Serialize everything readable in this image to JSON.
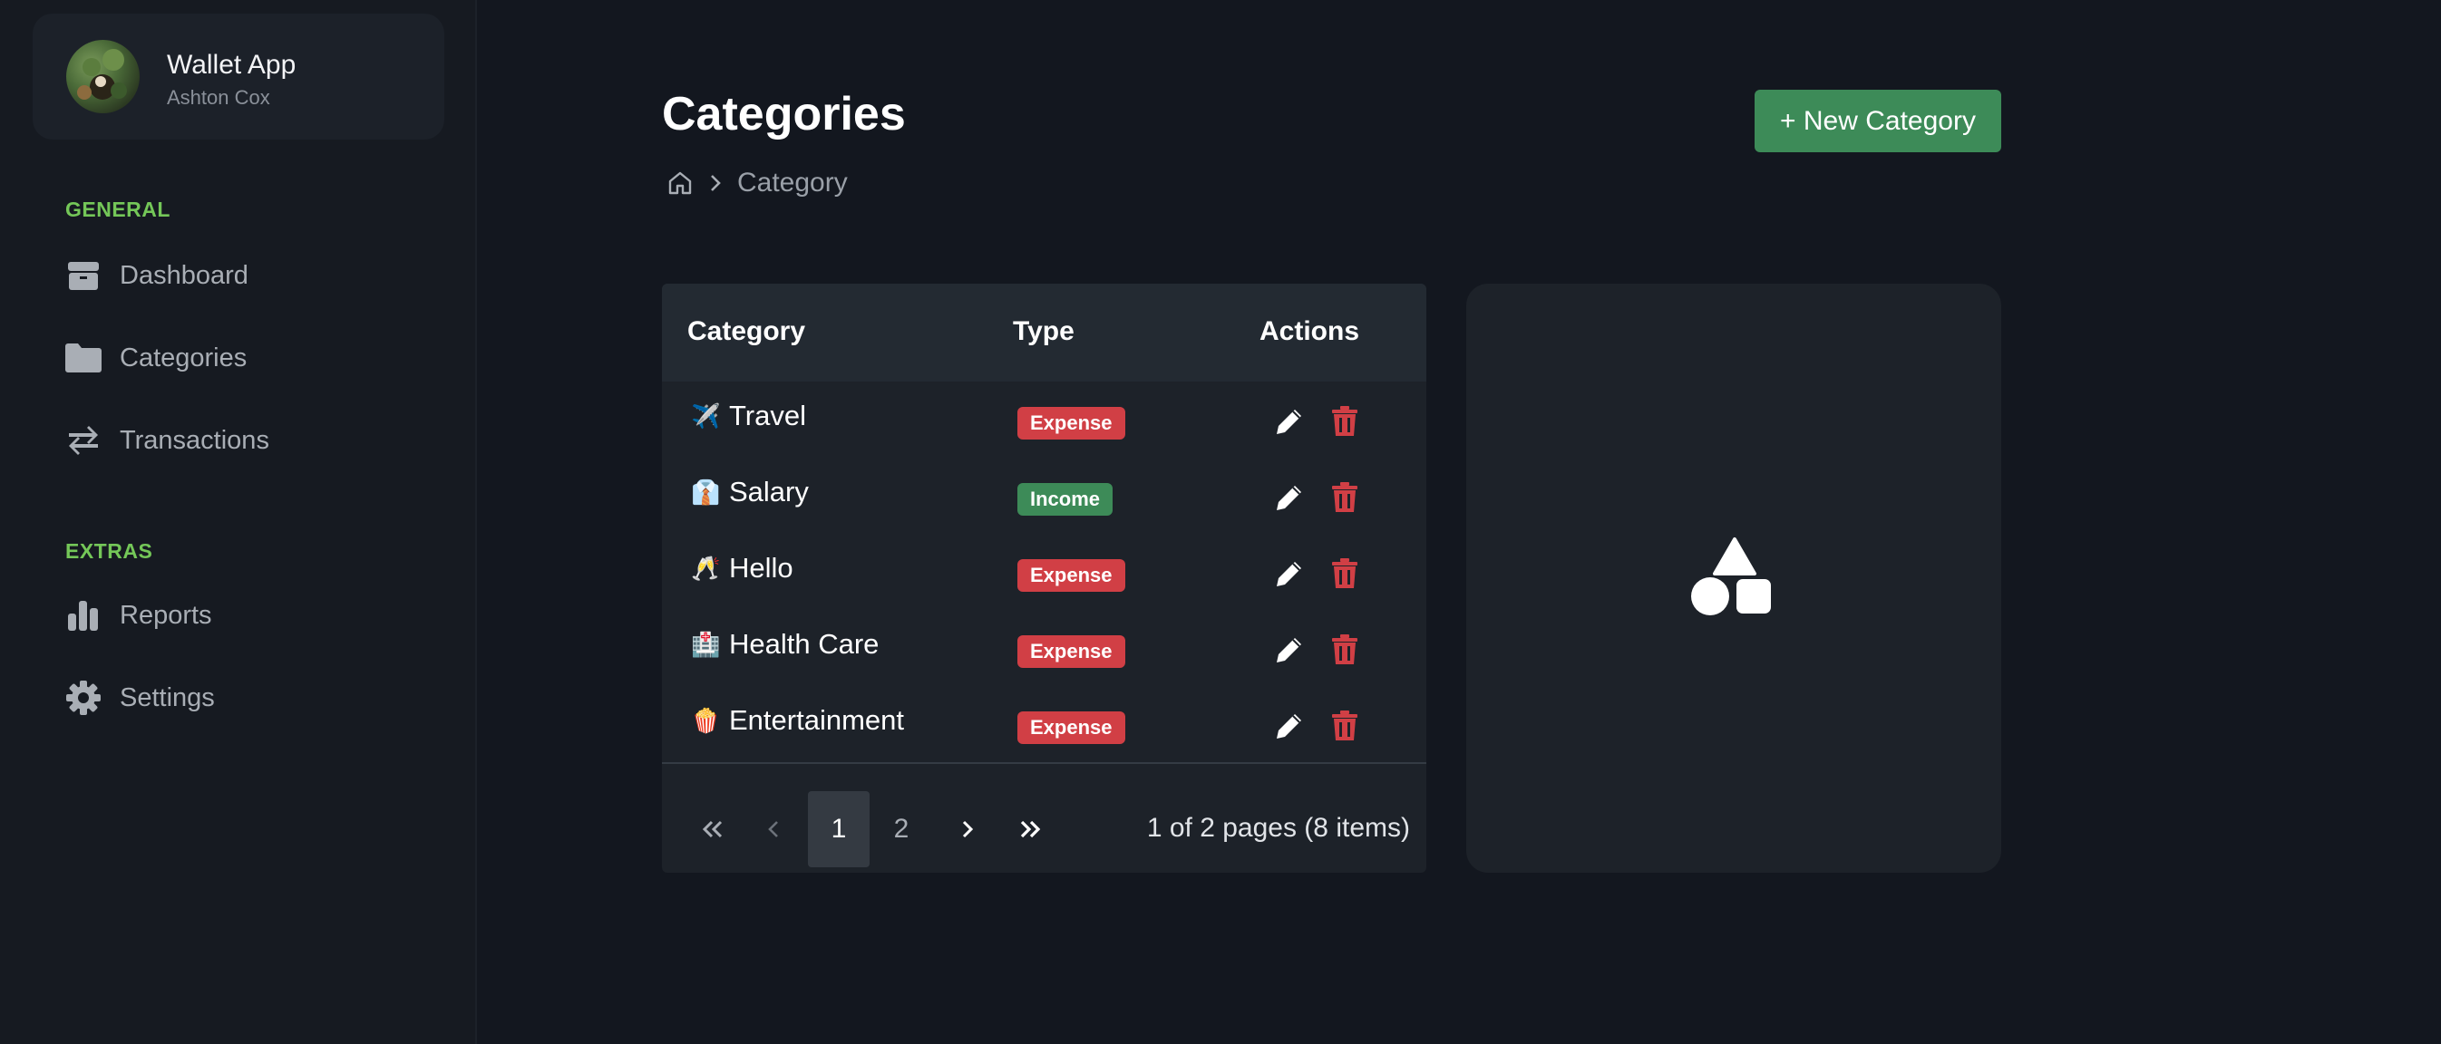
{
  "sidebar": {
    "app_name": "Wallet App",
    "user_name": "Ashton Cox",
    "sections": [
      {
        "label": "GENERAL",
        "items": [
          {
            "label": "Dashboard",
            "icon": "box-icon"
          },
          {
            "label": "Categories",
            "icon": "folder-icon"
          },
          {
            "label": "Transactions",
            "icon": "arrows-exchange-icon"
          }
        ]
      },
      {
        "label": "EXTRAS",
        "items": [
          {
            "label": "Reports",
            "icon": "bar-chart-icon"
          },
          {
            "label": "Settings",
            "icon": "gear-icon"
          }
        ]
      }
    ]
  },
  "header": {
    "title": "Categories",
    "breadcrumb": [
      "Category"
    ],
    "new_button_label": "+ New Category"
  },
  "table": {
    "columns": [
      "Category",
      "Type",
      "Actions"
    ],
    "rows": [
      {
        "emoji": "✈️",
        "name": "Travel",
        "type": "Expense"
      },
      {
        "emoji": "👔",
        "name": "Salary",
        "type": "Income"
      },
      {
        "emoji": "🥂",
        "name": "Hello",
        "type": "Expense"
      },
      {
        "emoji": "🏥",
        "name": "Health Care",
        "type": "Expense"
      },
      {
        "emoji": "🍿",
        "name": "Entertainment",
        "type": "Expense"
      }
    ],
    "pagination": {
      "pages": [
        "1",
        "2"
      ],
      "current_page": 1,
      "info": "1 of 2 pages (8 items)"
    }
  },
  "colors": {
    "accent_green": "#3d8b58",
    "section_label": "#74c758",
    "expense": "#d13f45",
    "income": "#3d8b58",
    "background": "#13171f"
  },
  "preview": {
    "icon": "shapes-icon"
  }
}
